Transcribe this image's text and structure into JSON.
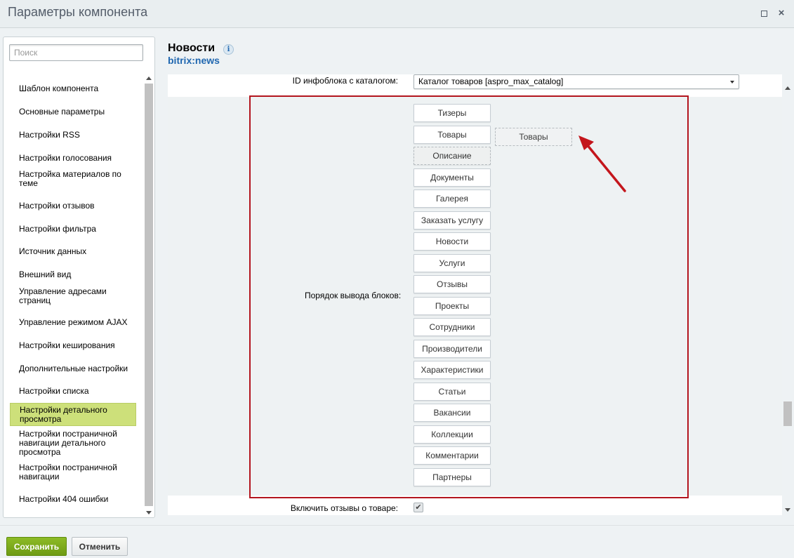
{
  "window": {
    "title": "Параметры компонента"
  },
  "sidebar": {
    "search_placeholder": "Поиск",
    "items": [
      "Шаблон компонента",
      "Основные параметры",
      "Настройки RSS",
      "Настройки голосования",
      "Настройка материалов по теме",
      "Настройки отзывов",
      "Настройки фильтра",
      "Источник данных",
      "Внешний вид",
      "Управление адресами страниц",
      "Управление режимом AJAX",
      "Настройки кеширования",
      "Дополнительные настройки",
      "Настройки списка",
      "Настройки детального просмотра",
      "Настройки постраничной навигации детального просмотра",
      "Настройки постраничной навигации",
      "Настройки 404 ошибки"
    ],
    "active_index": 14
  },
  "header": {
    "title": "Новости",
    "subtitle": "bitrix:news"
  },
  "content": {
    "top_row": {
      "label": "ID инфоблока с каталогом:",
      "value": "Каталог товаров [aspro_max_catalog]"
    },
    "order_label": "Порядок вывода блоков:",
    "blocks": [
      "Тизеры",
      "Товары",
      "Описание",
      "Документы",
      "Галерея",
      "Заказать услугу",
      "Новости",
      "Услуги",
      "Отзывы",
      "Проекты",
      "Сотрудники",
      "Производители",
      "Характеристики",
      "Статьи",
      "Вакансии",
      "Коллекции",
      "Комментарии",
      "Партнеры"
    ],
    "drag_ghost": "Товары",
    "bottom_row": {
      "label": "Включить отзывы о товаре:",
      "checked": true
    }
  },
  "footer": {
    "save_label": "Сохранить",
    "cancel_label": "Отменить"
  },
  "colors": {
    "highlight_border": "#b3151e",
    "active_item": "#cde07a",
    "link": "#2067b0",
    "save_button": "#7fae1e"
  }
}
